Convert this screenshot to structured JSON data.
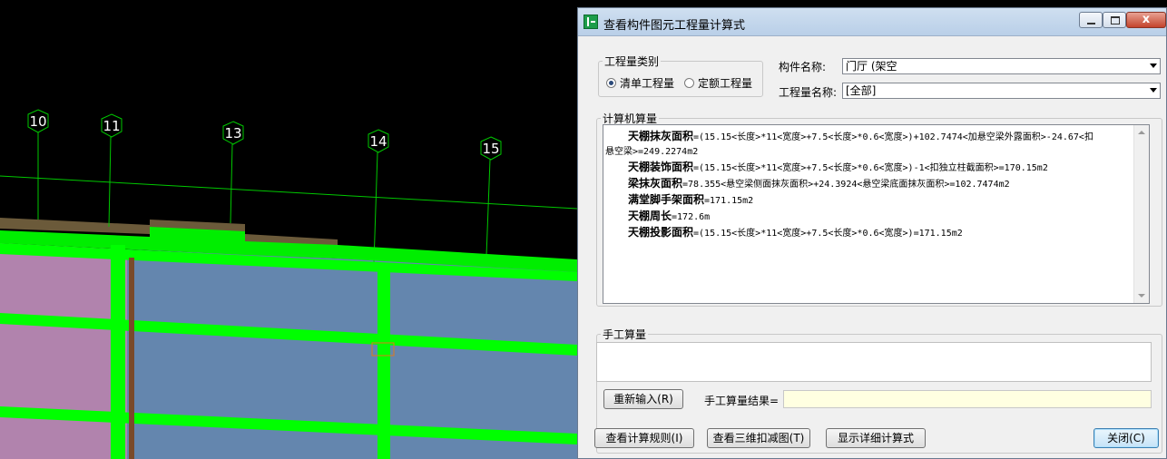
{
  "cad": {
    "axis_labels": [
      "10",
      "11",
      "13",
      "14",
      "15"
    ],
    "colors": {
      "background": "#000000",
      "beam": "#00ff00",
      "slab_blue": "#6486ae",
      "slab_pink": "#b183ad",
      "axis_line": "#00ff00",
      "wall_brown": "#8a6a3a"
    }
  },
  "dialog": {
    "title": "查看构件图元工程量计算式",
    "close_glyph": "x",
    "qtype_group": {
      "legend": "工程量类别",
      "option1": "清单工程量",
      "option2": "定额工程量",
      "selected": "清单工程量"
    },
    "component_name_label": "构件名称:",
    "component_name_value": "门厅 (架空",
    "qty_name_label": "工程量名称:",
    "qty_name_value": "[全部]",
    "calc_group_legend": "计算机算量",
    "calc_lines": [
      {
        "name": "天棚抹灰面积",
        "expr": "=(15.15<长度>*11<宽度>+7.5<长度>*0.6<宽度>)+102.7474<加悬空梁外露面积>-24.67<扣"
      },
      {
        "name": "",
        "expr": "悬空梁>=249.2274m2"
      },
      {
        "name": "天棚装饰面积",
        "expr": "=(15.15<长度>*11<宽度>+7.5<长度>*0.6<宽度>)-1<扣独立柱截面积>=170.15m2"
      },
      {
        "name": "梁抹灰面积",
        "expr": "=78.355<悬空梁侧面抹灰面积>+24.3924<悬空梁底面抹灰面积>=102.7474m2"
      },
      {
        "name": "满堂脚手架面积",
        "expr": "=171.15m2"
      },
      {
        "name": "天棚周长",
        "expr": "=172.6m"
      },
      {
        "name": "天棚投影面积",
        "expr": "=(15.15<长度>*11<宽度>+7.5<长度>*0.6<宽度>)=171.15m2"
      }
    ],
    "manual_group_legend": "手工算量",
    "manual_input_value": "",
    "reinput_button": "重新输入(R)",
    "manual_result_label": "手工算量结果=",
    "manual_result_value": "",
    "btn_rules": "查看计算规则(I)",
    "btn_3d": "查看三维扣减图(T)",
    "btn_detail": "显示详细计算式",
    "btn_close": "关闭(C)"
  }
}
